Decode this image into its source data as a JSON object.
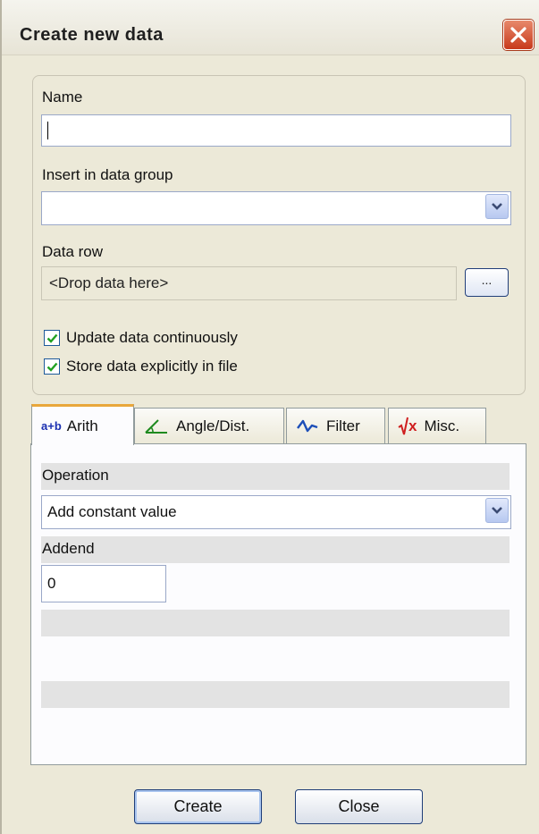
{
  "window": {
    "title": "Create new data"
  },
  "form": {
    "name_label": "Name",
    "name_value": "",
    "group_label": "Insert in data group",
    "group_value": "",
    "datarow_label": "Data row",
    "datarow_placeholder": "<Drop data here>",
    "browse_label": "...",
    "update_label": "Update data continuously",
    "update_checked": true,
    "store_label": "Store data explicitly in file",
    "store_checked": true
  },
  "tabs": [
    {
      "icon_text": "a+b",
      "label": "Arith",
      "icon": "arith-icon",
      "active": true
    },
    {
      "label": "Angle/Dist.",
      "icon": "angle-icon",
      "active": false
    },
    {
      "label": "Filter",
      "icon": "filter-wave-icon",
      "active": false
    },
    {
      "icon_text": "x",
      "label": "Misc.",
      "icon": "sqrt-icon",
      "active": false
    }
  ],
  "panel": {
    "operation_label": "Operation",
    "operation_value": "Add constant value",
    "addend_label": "Addend",
    "addend_value": "0"
  },
  "buttons": {
    "create": "Create",
    "close": "Close"
  },
  "colors": {
    "active_tab_accent": "#e9a73b",
    "close_button": "#d24a28",
    "check": "#21a121"
  }
}
